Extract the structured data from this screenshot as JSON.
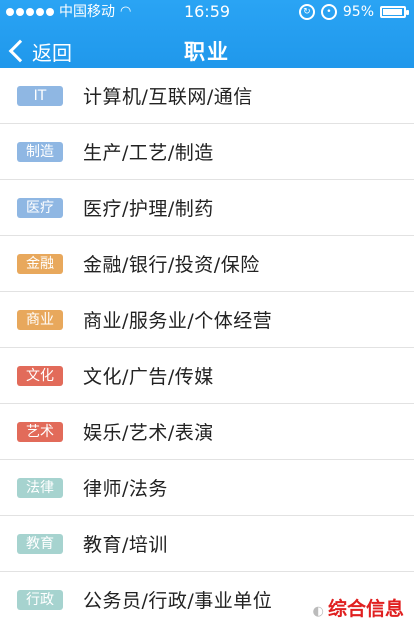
{
  "status": {
    "carrier": "中国移动",
    "time": "16:59",
    "battery": "95%"
  },
  "nav": {
    "back_label": "返回",
    "title": "职业"
  },
  "items": [
    {
      "badge": "IT",
      "label": "计算机/互联网/通信",
      "color": "#8fb7e3"
    },
    {
      "badge": "制造",
      "label": "生产/工艺/制造",
      "color": "#8fb7e3"
    },
    {
      "badge": "医疗",
      "label": "医疗/护理/制药",
      "color": "#8fb7e3"
    },
    {
      "badge": "金融",
      "label": "金融/银行/投资/保险",
      "color": "#e8a85c"
    },
    {
      "badge": "商业",
      "label": "商业/服务业/个体经营",
      "color": "#e8a85c"
    },
    {
      "badge": "文化",
      "label": "文化/广告/传媒",
      "color": "#e26b5a"
    },
    {
      "badge": "艺术",
      "label": "娱乐/艺术/表演",
      "color": "#e26b5a"
    },
    {
      "badge": "法律",
      "label": "律师/法务",
      "color": "#a6d3cf"
    },
    {
      "badge": "教育",
      "label": "教育/培训",
      "color": "#a6d3cf"
    },
    {
      "badge": "行政",
      "label": "公务员/行政/事业单位",
      "color": "#a6d3cf"
    }
  ],
  "watermark": {
    "text": "综合信息"
  }
}
